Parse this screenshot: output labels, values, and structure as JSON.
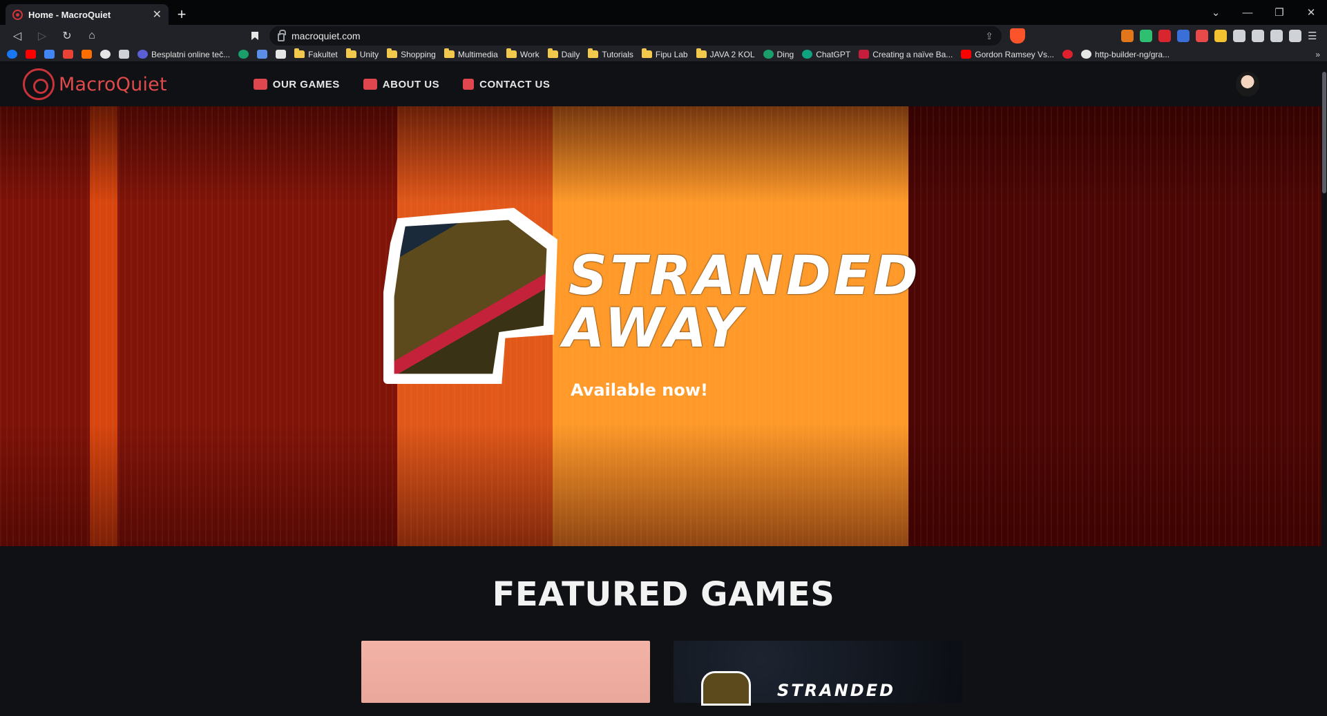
{
  "browser": {
    "tab": {
      "title": "Home - MacroQuiet",
      "close": "✕"
    },
    "new_tab": "+",
    "window_controls": {
      "dropdown": "⌄",
      "minimize": "—",
      "restore": "❐",
      "close": "✕"
    },
    "nav": {
      "back": "◁",
      "forward": "▷",
      "reload": "↻",
      "home": "⌂",
      "bookmark": "🔖"
    },
    "url": "macroquiet.com",
    "share_icon": "⇪",
    "bookmarks": [
      {
        "label": "Besplatni online teč...",
        "icon": "globe-icon",
        "color": "#5b5fd6"
      },
      {
        "label": "Fakultet",
        "icon": "folder-icon"
      },
      {
        "label": "Unity",
        "icon": "folder-icon"
      },
      {
        "label": "Shopping",
        "icon": "folder-icon"
      },
      {
        "label": "Multimedia",
        "icon": "folder-icon"
      },
      {
        "label": "Work",
        "icon": "folder-icon"
      },
      {
        "label": "Daily",
        "icon": "folder-icon"
      },
      {
        "label": "Tutorials",
        "icon": "folder-icon"
      },
      {
        "label": "Fipu Lab",
        "icon": "folder-icon"
      },
      {
        "label": "JAVA 2 KOL",
        "icon": "folder-icon"
      },
      {
        "label": "Ding",
        "icon": "ding-icon",
        "color": "#1a9e6a"
      },
      {
        "label": "ChatGPT",
        "icon": "chatgpt-icon",
        "color": "#10a37f"
      },
      {
        "label": "Creating a naïve Ba...",
        "icon": "site-icon",
        "color": "#c41e3a"
      },
      {
        "label": "Gordon Ramsey Vs...",
        "icon": "youtube-icon",
        "color": "#ff0000"
      },
      {
        "label": "http-builder-ng/gra...",
        "icon": "github-icon",
        "color": "#e6e6e6"
      }
    ],
    "bookmarks_more": "»"
  },
  "site": {
    "brand": "MacroQuiet",
    "nav": [
      {
        "label": "OUR GAMES",
        "icon": "gamepad-icon"
      },
      {
        "label": "ABOUT US",
        "icon": "newspaper-icon"
      },
      {
        "label": "CONTACT US",
        "icon": "contact-card-icon"
      }
    ],
    "hero": {
      "title_line1": "STRANDED",
      "title_line2": "AWAY",
      "subtitle": "Available now!"
    },
    "featured": {
      "heading": "FEATURED GAMES",
      "cards": [
        {
          "title": ""
        },
        {
          "title": "STRANDED"
        }
      ]
    }
  },
  "colors": {
    "accent": "#e0464d",
    "background": "#0f1115",
    "chrome": "#202227"
  }
}
